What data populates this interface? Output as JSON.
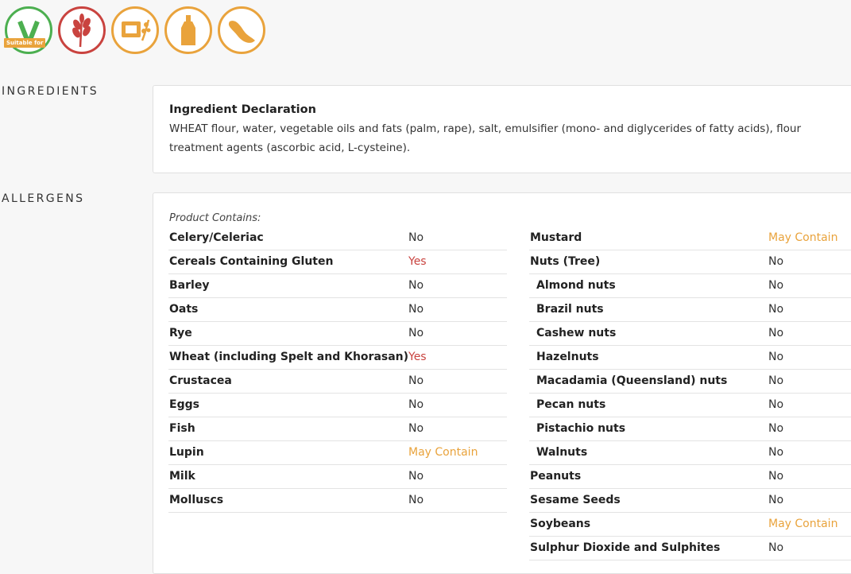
{
  "badges": [
    {
      "name": "vegetarian-badge",
      "label": "Suitable for",
      "color": "#4caf50"
    },
    {
      "name": "gluten-badge",
      "color": "#c9433f"
    },
    {
      "name": "mustard-badge",
      "color": "#e9a33c"
    },
    {
      "name": "sauce-badge",
      "color": "#e9a33c"
    },
    {
      "name": "soybean-badge",
      "color": "#e9a33c"
    }
  ],
  "ingredients": {
    "title": "INGREDIENTS",
    "heading": "Ingredient Declaration",
    "text": "WHEAT flour, water, vegetable oils and fats (palm, rape), salt, emulsifier (mono- and diglycerides of fatty acids), flour treatment agents (ascorbic acid, L-cysteine)."
  },
  "allergens": {
    "title": "ALLERGENS",
    "contains_label": "Product Contains:",
    "left": [
      {
        "name": "Celery/Celeriac",
        "value": "No"
      },
      {
        "name": "Cereals Containing Gluten",
        "value": "Yes"
      },
      {
        "name": "Barley",
        "value": "No"
      },
      {
        "name": "Oats",
        "value": "No"
      },
      {
        "name": "Rye",
        "value": "No"
      },
      {
        "name": "Wheat (including Spelt and Khorasan)",
        "value": "Yes"
      },
      {
        "name": "Crustacea",
        "value": "No"
      },
      {
        "name": "Eggs",
        "value": "No"
      },
      {
        "name": "Fish",
        "value": "No"
      },
      {
        "name": "Lupin",
        "value": "May Contain"
      },
      {
        "name": "Milk",
        "value": "No"
      },
      {
        "name": "Molluscs",
        "value": "No"
      }
    ],
    "right": [
      {
        "name": "Mustard",
        "value": "May Contain"
      },
      {
        "name": "Nuts (Tree)",
        "value": "No"
      },
      {
        "name": "Almond nuts",
        "value": "No",
        "sub": true
      },
      {
        "name": "Brazil nuts",
        "value": "No",
        "sub": true
      },
      {
        "name": "Cashew nuts",
        "value": "No",
        "sub": true
      },
      {
        "name": "Hazelnuts",
        "value": "No",
        "sub": true
      },
      {
        "name": "Macadamia (Queensland) nuts",
        "value": "No",
        "sub": true
      },
      {
        "name": "Pecan nuts",
        "value": "No",
        "sub": true
      },
      {
        "name": "Pistachio nuts",
        "value": "No",
        "sub": true
      },
      {
        "name": "Walnuts",
        "value": "No",
        "sub": true
      },
      {
        "name": "Peanuts",
        "value": "No"
      },
      {
        "name": "Sesame Seeds",
        "value": "No"
      },
      {
        "name": "Soybeans",
        "value": "May Contain"
      },
      {
        "name": "Sulphur Dioxide and Sulphites",
        "value": "No"
      }
    ]
  },
  "colors": {
    "yes": "#c9433f",
    "may_contain": "#e9a33c",
    "no": "#333333"
  }
}
